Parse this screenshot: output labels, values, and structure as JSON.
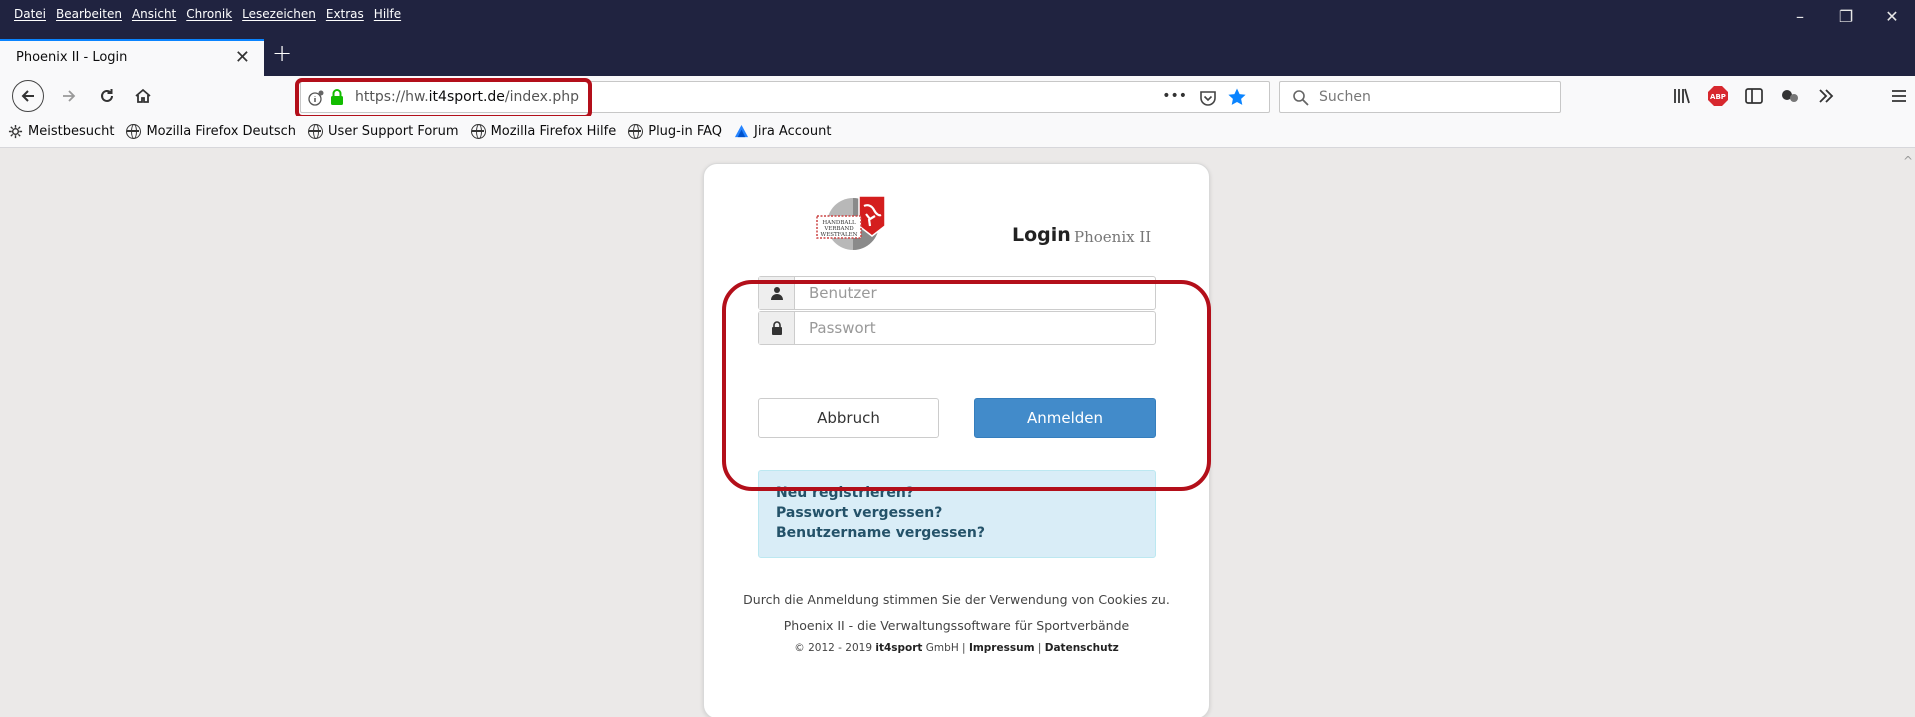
{
  "menu": {
    "items": [
      "Datei",
      "Bearbeiten",
      "Ansicht",
      "Chronik",
      "Lesezeichen",
      "Extras",
      "Hilfe"
    ]
  },
  "window_controls": {
    "minimize": "–",
    "restore": "❐",
    "close": "✕"
  },
  "tab": {
    "title": "Phoenix II - Login",
    "close": "✕",
    "new_tab": "+"
  },
  "nav": {
    "url_prefix": "https://hw.",
    "url_domain": "it4sport.de",
    "url_path": "/index.php",
    "page_actions": "•••",
    "search_placeholder": "Suchen"
  },
  "bookmarks": {
    "most_visited": "Meistbesucht",
    "items": [
      "Mozilla Firefox Deutsch",
      "User Support Forum",
      "Mozilla Firefox Hilfe",
      "Plug-in FAQ",
      "Jira Account"
    ]
  },
  "logo": {
    "line1": "HANDBALL",
    "line2": "VERBAND",
    "line3": "WESTFALEN"
  },
  "login": {
    "heading": "Login",
    "subheading": "Phoenix II",
    "user_placeholder": "Benutzer",
    "password_placeholder": "Passwort",
    "cancel_label": "Abbruch",
    "submit_label": "Anmelden"
  },
  "links": {
    "register": "Neu registrieren?",
    "forgot_password": "Passwort vergessen?",
    "forgot_username": "Benutzername vergessen?"
  },
  "footer": {
    "cookies": "Durch die Anmeldung stimmen Sie der Verwendung von Cookies zu.",
    "tagline": "Phoenix II - die Verwaltungssoftware für Sportverbände",
    "copyright_prefix": "© 2012 - 2019 ",
    "company": "it4sport",
    "company_suffix": " GmbH | ",
    "impressum": "Impressum",
    "separator": " | ",
    "datenschutz": "Datenschutz"
  },
  "colors": {
    "titlebar": "#202340",
    "highlight_red": "#b30f1a",
    "primary_button": "#428bca",
    "info_box": "#d9edf7",
    "page_bg": "#ebe9e8"
  }
}
